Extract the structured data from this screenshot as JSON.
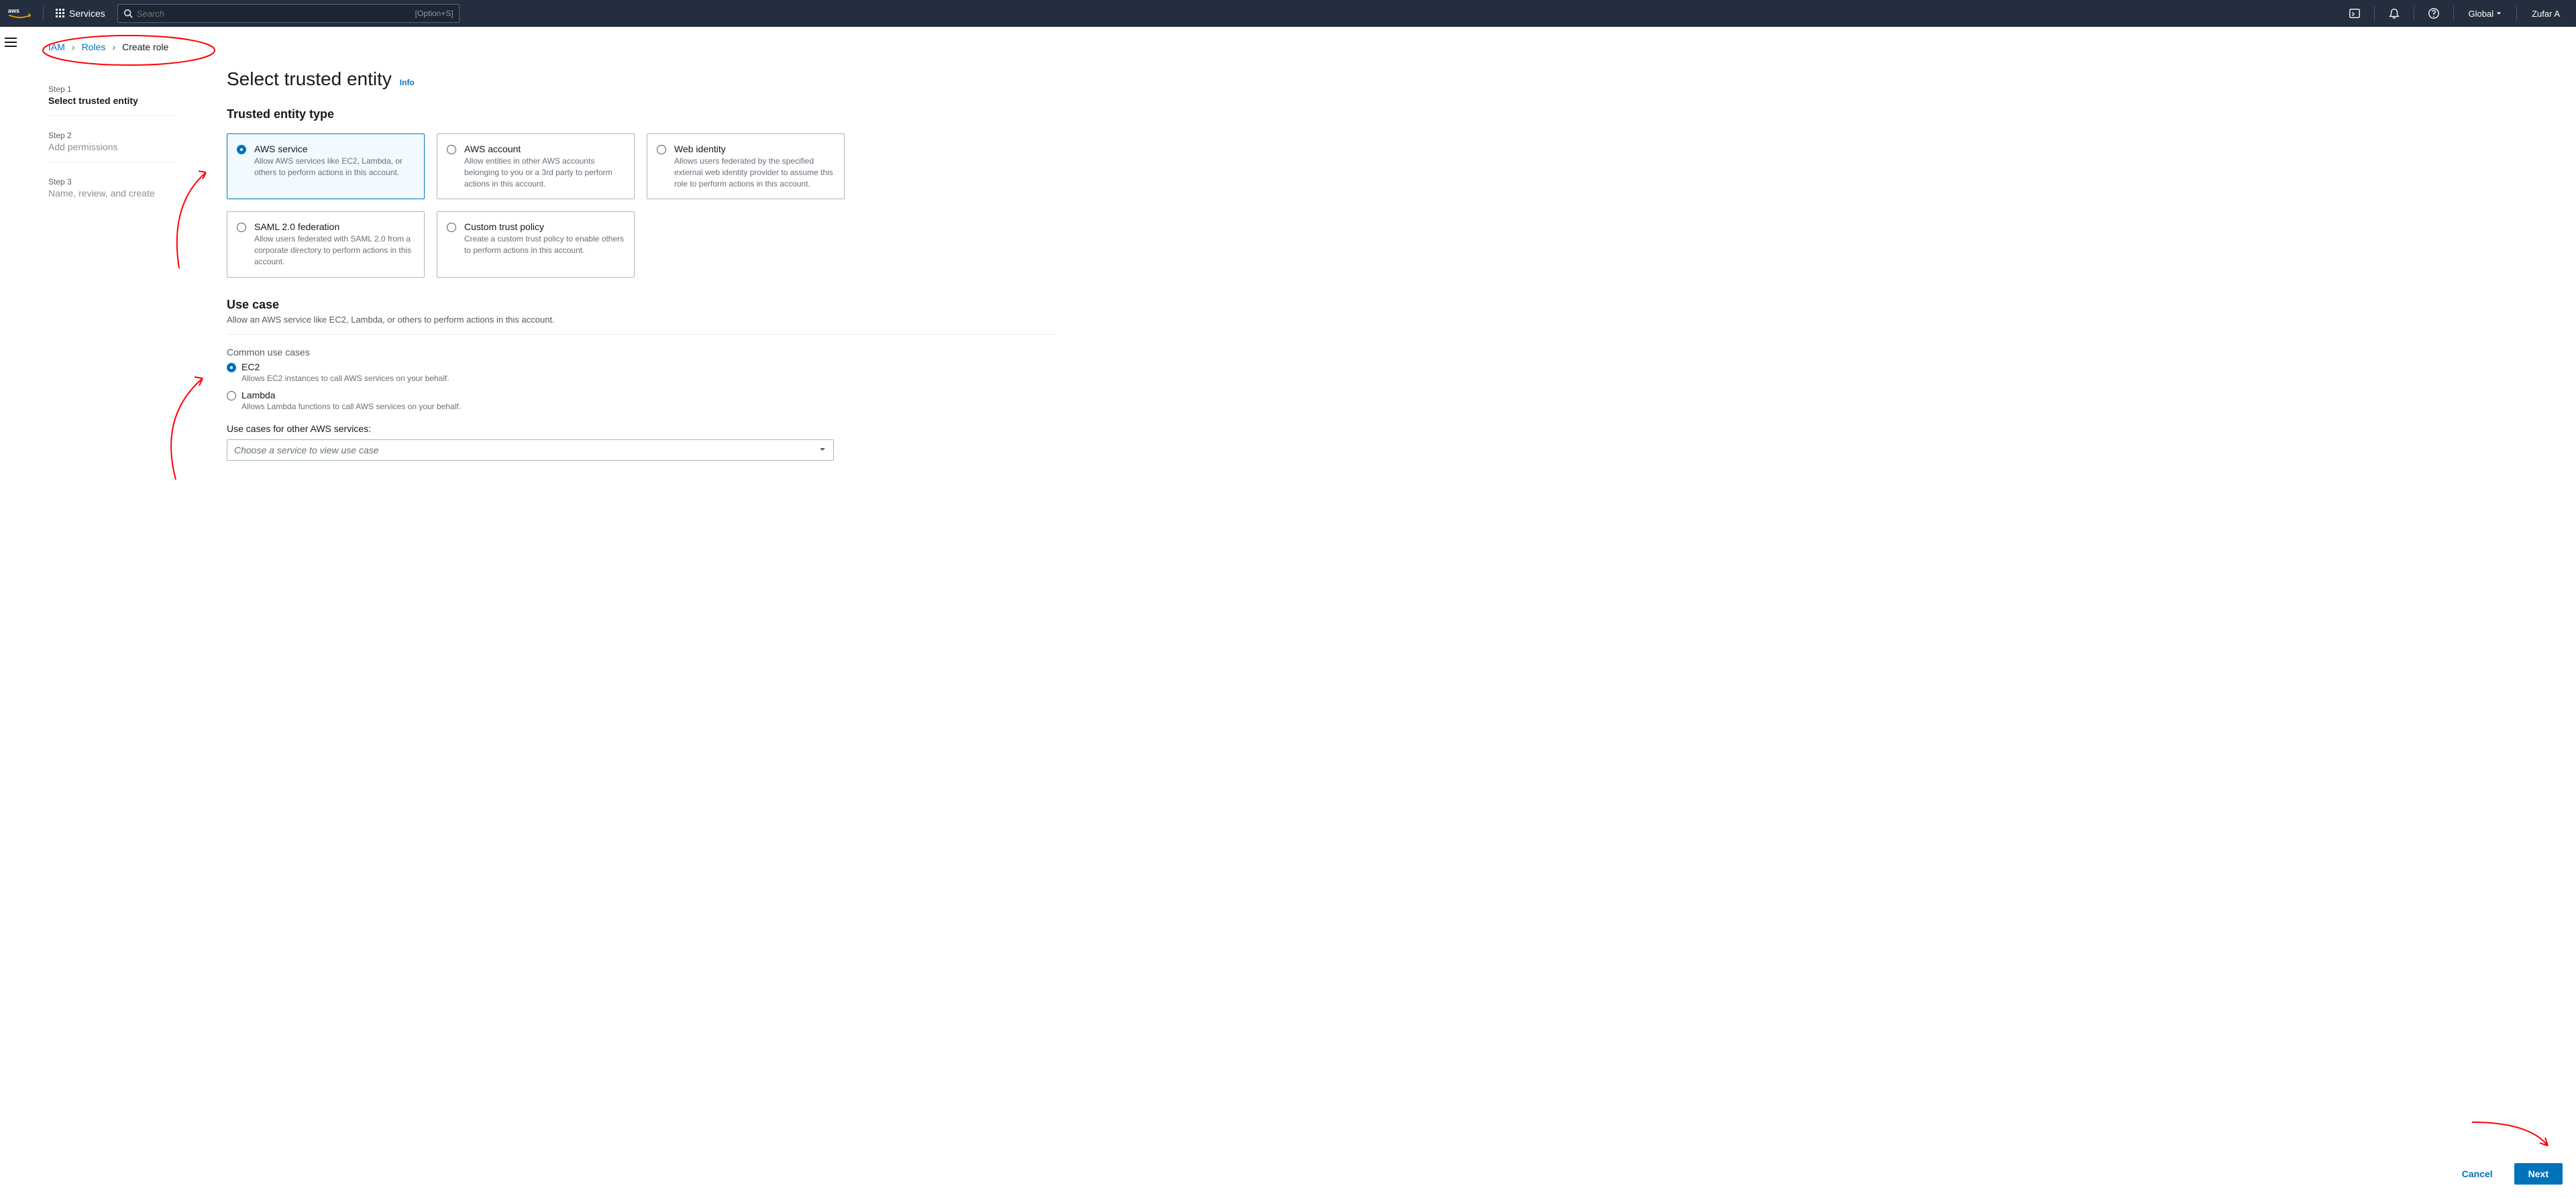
{
  "topnav": {
    "services_label": "Services",
    "search_placeholder": "Search",
    "search_kbd": "[Option+S]",
    "region_label": "Global",
    "user_label": "Zufar A"
  },
  "breadcrumb": {
    "items": [
      {
        "label": "IAM",
        "link": true
      },
      {
        "label": "Roles",
        "link": true
      },
      {
        "label": "Create role",
        "link": false
      }
    ]
  },
  "wizard": {
    "steps": [
      {
        "num": "Step 1",
        "title": "Select trusted entity",
        "active": true
      },
      {
        "num": "Step 2",
        "title": "Add permissions",
        "active": false
      },
      {
        "num": "Step 3",
        "title": "Name, review, and create",
        "active": false
      }
    ]
  },
  "main": {
    "heading": "Select trusted entity",
    "info": "Info",
    "entity_section_title": "Trusted entity type",
    "entities": [
      {
        "title": "AWS service",
        "desc": "Allow AWS services like EC2, Lambda, or others to perform actions in this account.",
        "selected": true
      },
      {
        "title": "AWS account",
        "desc": "Allow entities in other AWS accounts belonging to you or a 3rd party to perform actions in this account.",
        "selected": false
      },
      {
        "title": "Web identity",
        "desc": "Allows users federated by the specified external web identity provider to assume this role to perform actions in this account.",
        "selected": false
      },
      {
        "title": "SAML 2.0 federation",
        "desc": "Allow users federated with SAML 2.0 from a corporate directory to perform actions in this account.",
        "selected": false
      },
      {
        "title": "Custom trust policy",
        "desc": "Create a custom trust policy to enable others to perform actions in this account.",
        "selected": false
      }
    ],
    "use_case": {
      "heading": "Use case",
      "sub": "Allow an AWS service like EC2, Lambda, or others to perform actions in this account.",
      "common_label": "Common use cases",
      "common": [
        {
          "title": "EC2",
          "desc": "Allows EC2 instances to call AWS services on your behalf.",
          "selected": true
        },
        {
          "title": "Lambda",
          "desc": "Allows Lambda functions to call AWS services on your behalf.",
          "selected": false
        }
      ],
      "other_label": "Use cases for other AWS services:",
      "select_placeholder": "Choose a service to view use case"
    },
    "footer": {
      "cancel": "Cancel",
      "next": "Next"
    }
  }
}
